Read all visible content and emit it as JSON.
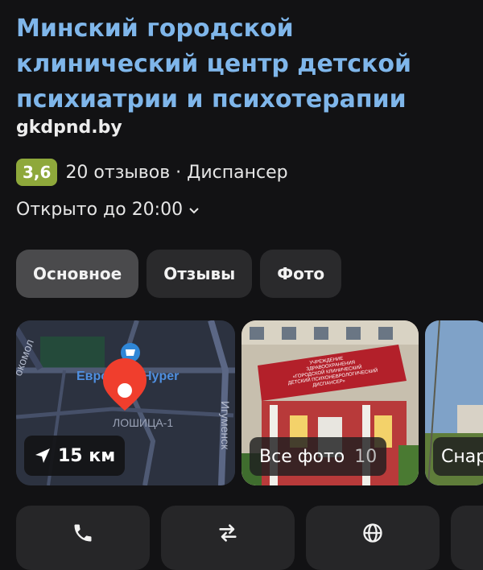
{
  "place": {
    "title": "Минский городской клинический центр детской психиатрии и психотерапии",
    "website": "gkdpnd.by",
    "rating": "3,6",
    "reviews_and_category": "20 отзывов · Диспансер",
    "hours": "Открыто до 20:00",
    "colors": {
      "title": "#7fb6ea",
      "rating_badge": "#8ea83b",
      "background": "#121214"
    }
  },
  "tabs": [
    {
      "label": "Основное",
      "active": true
    },
    {
      "label": "Отзывы",
      "active": false
    },
    {
      "label": "Фото",
      "active": false
    }
  ],
  "map_card": {
    "labels": {
      "store": "Евро",
      "store2": "Hyper",
      "district": "ЛОШИЦА-1",
      "street": "Игуменск",
      "street2": "окомол"
    },
    "distance": "15 км"
  },
  "photo_card": {
    "label": "Все фото",
    "count": "10",
    "sign_lines": [
      "УЧРЕЖДЕНИЕ",
      "ЗДРАВООХРАНЕНИЯ",
      "«ГОРОДСКОЙ КЛИНИЧЕСКИЙ",
      "ДЕТСКИЙ ПСИХОНЕВРОЛОГИЧЕСКИЙ",
      "ДИСПАНСЕР»"
    ]
  },
  "photo2_card": {
    "label": "Снар"
  },
  "actions": [
    {
      "icon": "phone-icon"
    },
    {
      "icon": "route-icon"
    },
    {
      "icon": "globe-icon"
    }
  ]
}
